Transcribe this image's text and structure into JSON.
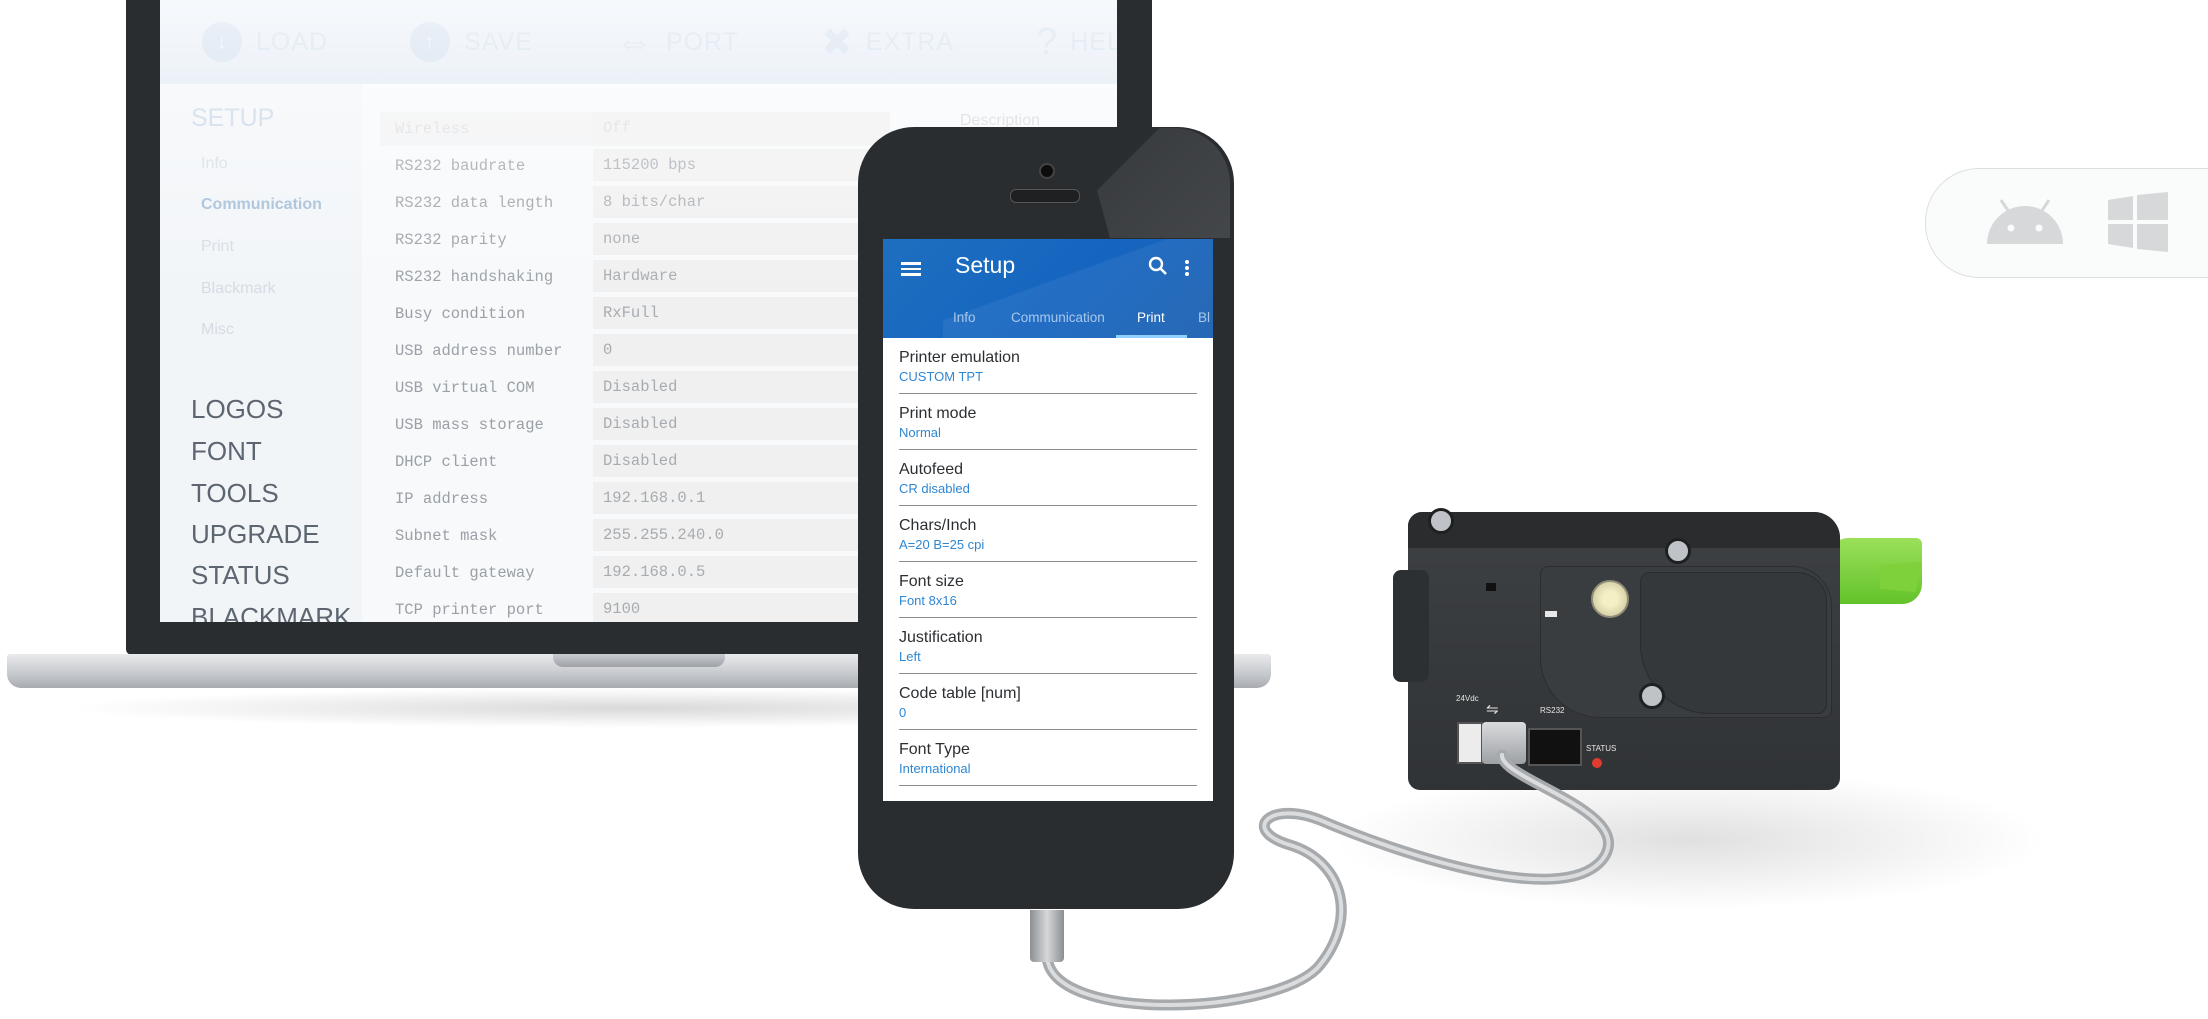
{
  "laptop": {
    "toolbar": [
      {
        "label": "LOAD",
        "icon": "download-circle-icon"
      },
      {
        "label": "SAVE",
        "icon": "upload-circle-icon"
      },
      {
        "label": "PORT",
        "icon": "plug-icon"
      },
      {
        "label": "EXTRA",
        "icon": "tools-icon"
      },
      {
        "label": "HELP",
        "icon": "question-icon"
      }
    ],
    "sidebar": {
      "section_title": "SETUP",
      "sub_items": [
        "Info",
        "Communication",
        "Print",
        "Blackmark",
        "Misc"
      ],
      "active_sub_item": "Communication",
      "main_items": [
        "LOGOS",
        "FONT",
        "TOOLS",
        "UPGRADE",
        "STATUS",
        "BLACKMARK"
      ]
    },
    "form": [
      {
        "label": "Wireless",
        "value": "Off"
      },
      {
        "label": "RS232 baudrate",
        "value": "115200 bps"
      },
      {
        "label": "RS232 data length",
        "value": "8 bits/char"
      },
      {
        "label": "RS232 parity",
        "value": "none"
      },
      {
        "label": "RS232 handshaking",
        "value": "Hardware"
      },
      {
        "label": "Busy condition",
        "value": "RxFull"
      },
      {
        "label": "USB address number",
        "value": "0"
      },
      {
        "label": "USB virtual COM",
        "value": "Disabled"
      },
      {
        "label": "USB mass storage",
        "value": "Disabled"
      },
      {
        "label": "DHCP client",
        "value": "Disabled"
      },
      {
        "label": "IP address",
        "value": "192.168.0.1"
      },
      {
        "label": "Subnet mask",
        "value": "255.255.240.0"
      },
      {
        "label": "Default gateway",
        "value": "192.168.0.5"
      },
      {
        "label": "TCP printer port",
        "value": "9100"
      }
    ],
    "description_header": "Description"
  },
  "phone": {
    "title": "Setup",
    "tabs": [
      "Info",
      "Communication",
      "Print",
      "Bl"
    ],
    "active_tab": "Print",
    "settings": [
      {
        "title": "Printer emulation",
        "value": "CUSTOM TPT"
      },
      {
        "title": "Print mode",
        "value": "Normal"
      },
      {
        "title": "Autofeed",
        "value": "CR disabled"
      },
      {
        "title": "Chars/Inch",
        "value": "A=20 B=25 cpi"
      },
      {
        "title": "Font size",
        "value": "Font 8x16"
      },
      {
        "title": "Justification",
        "value": "Left"
      },
      {
        "title": "Code table [num]",
        "value": "0"
      },
      {
        "title": "Font Type",
        "value": "International"
      }
    ]
  },
  "printer": {
    "labels": {
      "power": "24Vdc",
      "rs232": "RS232",
      "status": "STATUS"
    }
  },
  "os_badges": [
    "android-icon",
    "windows-icon"
  ],
  "colors": {
    "app_bar": "#1565c0",
    "setting_value": "#2f86d1",
    "printer_accent": "#7fd13b",
    "status_led": "#e03b2f"
  }
}
